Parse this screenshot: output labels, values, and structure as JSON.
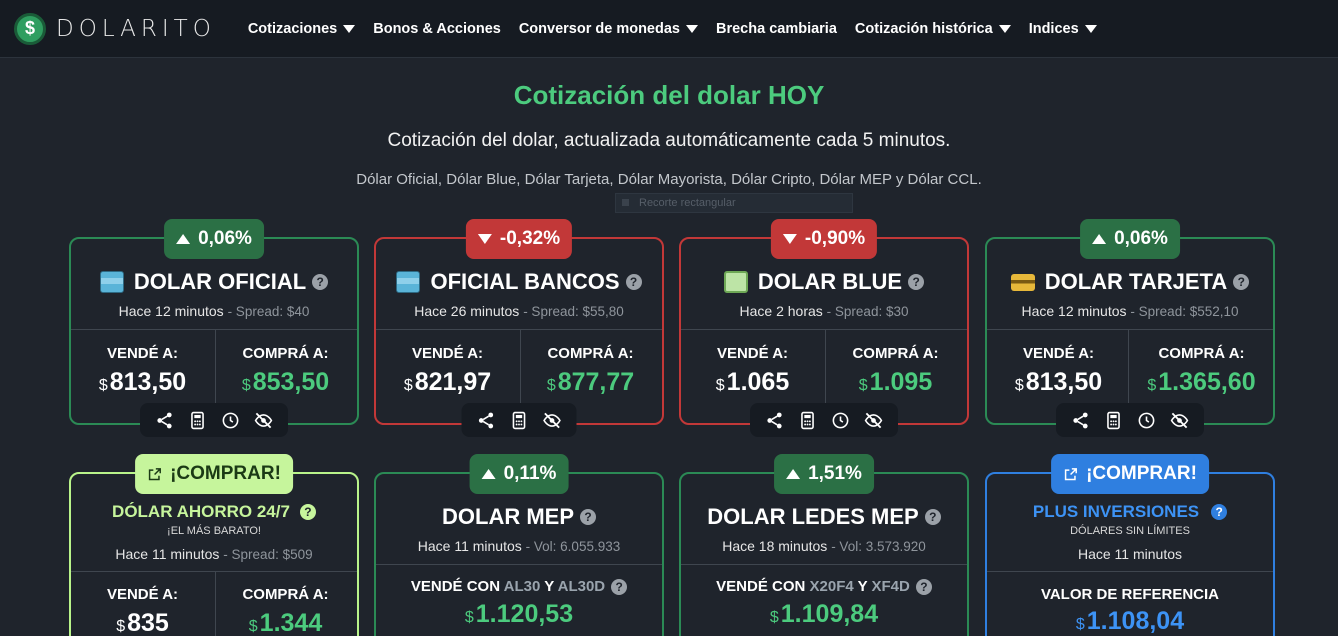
{
  "brand": {
    "name": "DOLARITO",
    "logo_glyph": "$"
  },
  "nav": {
    "items": [
      {
        "label": "Cotizaciones",
        "dropdown": true
      },
      {
        "label": "Bonos & Acciones",
        "dropdown": false
      },
      {
        "label": "Conversor de monedas",
        "dropdown": true
      },
      {
        "label": "Brecha cambiaria",
        "dropdown": false
      },
      {
        "label": "Cotización histórica",
        "dropdown": true
      },
      {
        "label": "Indices",
        "dropdown": true
      }
    ]
  },
  "hero": {
    "title": "Cotización del dolar HOY",
    "subtitle": "Cotización del dolar, actualizada automáticamente cada 5 minutos.",
    "types": "Dólar Oficial, Dólar Blue, Dólar Tarjeta, Dólar Mayorista, Dólar Cripto, Dólar MEP y Dólar CCL.",
    "snip_overlay": "Recorte rectangular"
  },
  "colors": {
    "green": "#4ccb7e",
    "red": "#c23838",
    "lime": "#c6f59c",
    "blue": "#2f7fe0",
    "bg": "#1f242c"
  },
  "labels": {
    "sell": "VENDÉ A:",
    "buy": "COMPRÁ A:",
    "currency": "$",
    "help": "?"
  },
  "cards": [
    {
      "badge": "0,06%",
      "title": "DOLAR OFICIAL",
      "icon": "bank-icon",
      "time": "Hace 12 minutos",
      "extra": "- Spread: $40",
      "sell": "813,50",
      "buy": "853,50"
    },
    {
      "badge": "-0,32%",
      "title": "OFICIAL BANCOS",
      "icon": "bank-icon",
      "time": "Hace 26 minutos",
      "extra": "- Spread: $55,80",
      "sell": "821,97",
      "buy": "877,77"
    },
    {
      "badge": "-0,90%",
      "title": "DOLAR BLUE",
      "icon": "cash-icon",
      "time": "Hace 2 horas",
      "extra": "- Spread: $30",
      "sell": "1.065",
      "buy": "1.095"
    },
    {
      "badge": "0,06%",
      "title": "DOLAR TARJETA",
      "icon": "credit-card-icon",
      "time": "Hace 12 minutos",
      "extra": "- Spread: $552,10",
      "sell": "813,50",
      "buy": "1.365,60"
    },
    {
      "badge": "¡COMPRAR!",
      "title": "DÓLAR AHORRO 24/7",
      "tagline": "¡EL MÁS BARATO!",
      "time": "Hace 11 minutos",
      "extra": "- Spread: $509",
      "sell": "835",
      "buy": "1.344"
    },
    {
      "badge": "0,11%",
      "title": "DOLAR MEP",
      "time": "Hace 11 minutos",
      "extra": "- Vol: 6.055.933",
      "sell_prefix": "VENDÉ CON",
      "bond_a": "AL30",
      "joiner": "Y",
      "bond_b": "AL30D",
      "price": "1.120,53"
    },
    {
      "badge": "1,51%",
      "title": "DOLAR LEDES MEP",
      "time": "Hace 18 minutos",
      "extra": "- Vol: 3.573.920",
      "sell_prefix": "VENDÉ CON",
      "bond_a": "X20F4",
      "joiner": "Y",
      "bond_b": "XF4D",
      "price": "1.109,84"
    },
    {
      "badge": "¡COMPRAR!",
      "title": "PLUS INVERSIONES",
      "tagline": "DÓLARES SIN LÍMITES",
      "time": "Hace 11 minutos",
      "ref_label": "VALOR DE REFERENCIA",
      "price": "1.108,04"
    }
  ]
}
